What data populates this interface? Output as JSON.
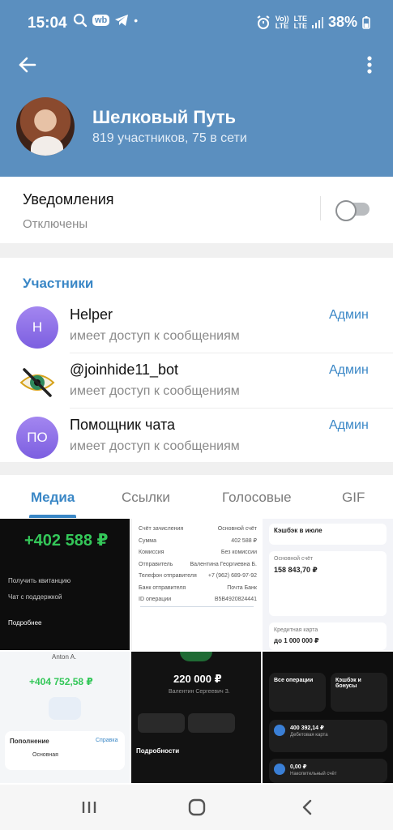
{
  "status_bar": {
    "time": "15:04",
    "wb_badge": "wb",
    "lte_top": "Vo))",
    "lte_bottom": "LTE",
    "lte2_top": "LTE",
    "lte2_bottom": "LTE",
    "battery": "38%"
  },
  "header": {
    "title": "Шелковый Путь",
    "subtitle": "819 участников, 75 в сети"
  },
  "notifications": {
    "title": "Уведомления",
    "state": "Отключены",
    "enabled": false
  },
  "members": {
    "section_title": "Участники",
    "items": [
      {
        "initials": "H",
        "name": "Helper",
        "status": "имеет доступ к сообщениям",
        "role": "Админ"
      },
      {
        "initials": "",
        "name": "@joinhide11_bot",
        "status": "имеет доступ к сообщениям",
        "role": "Админ"
      },
      {
        "initials": "ПО",
        "name": "Помощник чата",
        "status": "имеет доступ к сообщениям",
        "role": "Админ"
      }
    ]
  },
  "tabs": [
    {
      "label": "Медиа"
    },
    {
      "label": "Ссылки"
    },
    {
      "label": "Голосовые"
    },
    {
      "label": "GIF"
    }
  ],
  "media": {
    "t1": {
      "amount": "+402 588 ₽",
      "row1": "Получить квитанцию",
      "row2": "Чат с поддержкой",
      "row3": "Подробнее"
    },
    "t2": {
      "rows": [
        "Счёт зачисления",
        "Сумма",
        "Комиссия",
        "Отправитель",
        "Телефон отправителя",
        "Банк отправителя",
        "ID операции"
      ],
      "values": [
        "Основной счёт",
        "402 588 ₽",
        "Без комиссии",
        "Валентина Георгиевна Б.",
        "+7 (962) 689-97-92",
        "Почта Банк",
        "B5B4920824441"
      ]
    },
    "t3": {
      "cashback": "Кэшбэк в июле",
      "account": "Основной счёт",
      "balance": "158 843,70 ₽",
      "credit": "Кредитная карта",
      "credit_limit": "до 1 000 000 ₽"
    },
    "t4": {
      "name": "Anton A.",
      "amount": "+404 752,58 ₽",
      "section": "Пополнение",
      "link": "Справка",
      "account": "Основная"
    },
    "t5": {
      "amount": "220 000 ₽",
      "name": "Валентин Сергеевич З.",
      "details": "Подробности"
    },
    "t6": {
      "all_ops": "Все операции",
      "cashback": "Кэшбэк и бонусы",
      "card_balance": "400 392,14 ₽",
      "card_name": "Дебетовая карта",
      "savings": "0,00 ₽",
      "savings_name": "Накопительный счёт"
    }
  },
  "colors": {
    "header": "#5b8fbf",
    "accent": "#3a87c6",
    "avatar_purple": "#7c5fe0"
  }
}
